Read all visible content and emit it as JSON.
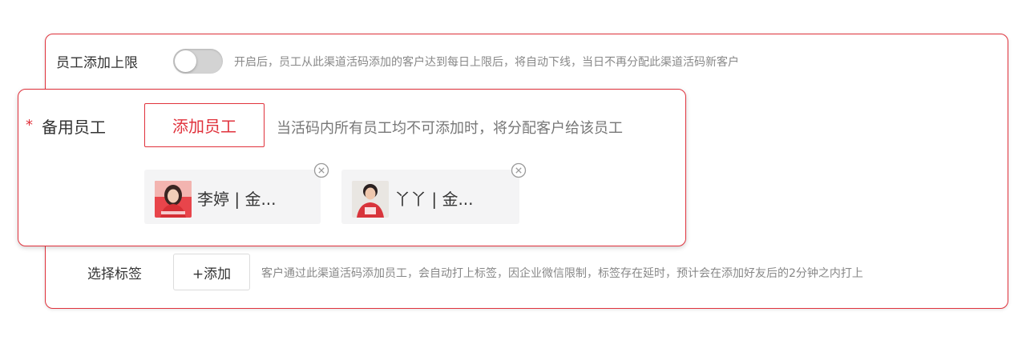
{
  "daily_limit": {
    "label": "员工添加上限",
    "toggle_on": false,
    "hint": "开启后，员工从此渠道活码添加的客户达到每日上限后，将自动下线，当日不再分配此渠道活码新客户"
  },
  "backup_staff": {
    "required_mark": "*",
    "label": "备用员工",
    "add_button_label": "添加员工",
    "hint": "当活码内所有员工均不可添加时，将分配客户给该员工",
    "staff": [
      {
        "name": "李婷 | 金...",
        "avatar_icon": "user-photo-icon",
        "remove_icon": "close-circle-icon"
      },
      {
        "name": "丫丫 | 金...",
        "avatar_icon": "user-photo-icon",
        "remove_icon": "close-circle-icon"
      }
    ]
  },
  "tags": {
    "label": "选择标签",
    "add_button_label": "+添加",
    "hint": "客户通过此渠道活码添加员工，会自动打上标签，因企业微信限制，标签存在延时，预计会在添加好友后的2分钟之内打上"
  },
  "colors": {
    "accent": "#e0323c",
    "toggle_off": "#d3d3d3",
    "chip_bg": "#f4f4f5",
    "hint_text": "#888888"
  }
}
